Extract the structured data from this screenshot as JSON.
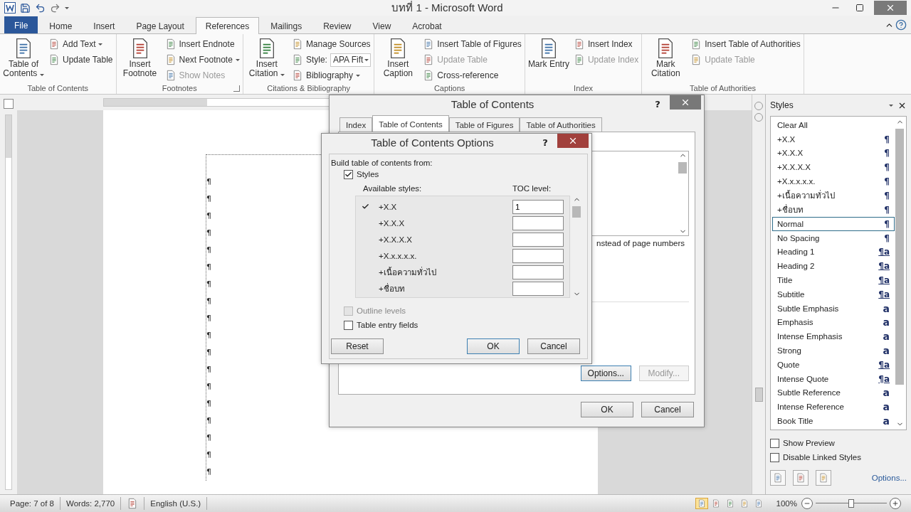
{
  "window": {
    "title": "บทที่ 1 - Microsoft Word"
  },
  "ribbon_tabs": [
    {
      "label": "File",
      "selected": false,
      "kind": "file"
    },
    {
      "label": "Home",
      "selected": false,
      "kind": "tab"
    },
    {
      "label": "Insert",
      "selected": false,
      "kind": "tab"
    },
    {
      "label": "Page Layout",
      "selected": false,
      "kind": "tab"
    },
    {
      "label": "References",
      "selected": true,
      "kind": "tab"
    },
    {
      "label": "Mailings",
      "selected": false,
      "kind": "tab"
    },
    {
      "label": "Review",
      "selected": false,
      "kind": "tab"
    },
    {
      "label": "View",
      "selected": false,
      "kind": "tab"
    },
    {
      "label": "Acrobat",
      "selected": false,
      "kind": "tab"
    }
  ],
  "ribbon_groups": [
    {
      "label": "Table of Contents",
      "launcher": false,
      "items": [
        {
          "kind": "large",
          "label": "Table of Contents",
          "dropdown": true,
          "disabled": false
        },
        {
          "kind": "small",
          "label": "Add Text",
          "dropdown": true,
          "disabled": false
        },
        {
          "kind": "small",
          "label": "Update Table",
          "dropdown": false,
          "disabled": false
        }
      ]
    },
    {
      "label": "Footnotes",
      "launcher": true,
      "items": [
        {
          "kind": "large",
          "label": "Insert Footnote",
          "dropdown": false,
          "disabled": false
        },
        {
          "kind": "small",
          "label": "Insert Endnote",
          "dropdown": false,
          "disabled": false
        },
        {
          "kind": "small",
          "label": "Next Footnote",
          "dropdown": true,
          "disabled": false
        },
        {
          "kind": "small",
          "label": "Show Notes",
          "dropdown": false,
          "disabled": true
        }
      ]
    },
    {
      "label": "Citations & Bibliography",
      "launcher": false,
      "items": [
        {
          "kind": "large",
          "label": "Insert Citation",
          "dropdown": true,
          "disabled": false
        },
        {
          "kind": "small",
          "label": "Manage Sources",
          "dropdown": false,
          "disabled": false
        },
        {
          "kind": "combo",
          "label": "Style:",
          "value": "APA Fift",
          "dropdown": true,
          "disabled": false
        },
        {
          "kind": "small",
          "label": "Bibliography",
          "dropdown": true,
          "disabled": false
        }
      ]
    },
    {
      "label": "Captions",
      "launcher": false,
      "items": [
        {
          "kind": "large",
          "label": "Insert Caption",
          "dropdown": false,
          "disabled": false
        },
        {
          "kind": "small",
          "label": "Insert Table of Figures",
          "dropdown": false,
          "disabled": false
        },
        {
          "kind": "small",
          "label": "Update Table",
          "dropdown": false,
          "disabled": true
        },
        {
          "kind": "small",
          "label": "Cross-reference",
          "dropdown": false,
          "disabled": false
        }
      ]
    },
    {
      "label": "Index",
      "launcher": false,
      "items": [
        {
          "kind": "large",
          "label": "Mark Entry",
          "dropdown": false,
          "disabled": false
        },
        {
          "kind": "small",
          "label": "Insert Index",
          "dropdown": false,
          "disabled": false
        },
        {
          "kind": "small",
          "label": "Update Index",
          "dropdown": false,
          "disabled": true
        }
      ]
    },
    {
      "label": "Table of Authorities",
      "launcher": false,
      "items": [
        {
          "kind": "large",
          "label": "Mark Citation",
          "dropdown": false,
          "disabled": false
        },
        {
          "kind": "small",
          "label": "Insert Table of Authorities",
          "dropdown": false,
          "disabled": false
        },
        {
          "kind": "small",
          "label": "Update Table",
          "dropdown": false,
          "disabled": true
        }
      ]
    }
  ],
  "document": {
    "paragraph_marks": [
      "¶",
      "¶",
      "¶",
      "¶",
      "¶",
      "¶",
      "¶",
      "¶",
      "¶",
      "¶",
      "¶",
      "¶",
      "¶",
      "¶",
      "¶",
      "¶",
      "¶",
      "¶"
    ]
  },
  "toc_dialog": {
    "title": "Table of Contents",
    "help": "?",
    "tabs": [
      {
        "label": "Index",
        "selected": false
      },
      {
        "label": "Table of Contents",
        "selected": true
      },
      {
        "label": "Table of Figures",
        "selected": false
      },
      {
        "label": "Table of Authorities",
        "selected": false
      }
    ],
    "hyperlinks_text": "nstead of page numbers",
    "buttons": [
      {
        "label": "Options...",
        "disabled": false
      },
      {
        "label": "Modify...",
        "disabled": true
      }
    ],
    "footer_buttons": [
      "OK",
      "Cancel"
    ]
  },
  "options_dialog": {
    "title": "Table of Contents Options",
    "help": "?",
    "build_from": "Build table of contents from:",
    "styles_checkbox": {
      "label": "Styles",
      "checked": true
    },
    "columns": [
      "Available styles:",
      "TOC level:"
    ],
    "styles": [
      {
        "name": "+X.X",
        "marked": true,
        "toc_level": "1"
      },
      {
        "name": "+X.X.X",
        "marked": false
      },
      {
        "name": "+X.X.X.X",
        "marked": false
      },
      {
        "name": "+X.x.x.x.x.",
        "marked": false
      },
      {
        "name": "+เนื้อความทั่วไป",
        "marked": false
      },
      {
        "name": "+ชื่อบท",
        "marked": false
      }
    ],
    "options": [
      {
        "label": "Outline levels",
        "checked": false,
        "disabled": true
      },
      {
        "label": "Table entry fields",
        "checked": false,
        "disabled": false
      }
    ],
    "buttons": [
      {
        "label": "Reset",
        "kind": "left",
        "default": false
      },
      {
        "label": "OK",
        "kind": "right",
        "default": true
      },
      {
        "label": "Cancel",
        "kind": "right",
        "default": false
      }
    ]
  },
  "styles_pane": {
    "title": "Styles",
    "items": [
      {
        "name": "Clear All",
        "selected": false
      },
      {
        "name": "+X.X",
        "symbol": "¶",
        "kind": "paragraph",
        "selected": false
      },
      {
        "name": "+X.X.X",
        "symbol": "¶",
        "kind": "paragraph",
        "selected": false
      },
      {
        "name": "+X.X.X.X",
        "symbol": "¶",
        "kind": "paragraph",
        "selected": false
      },
      {
        "name": "+X.x.x.x.x.",
        "symbol": "¶",
        "kind": "paragraph",
        "selected": false
      },
      {
        "name": "+เนื้อความทั่วไป",
        "symbol": "¶",
        "kind": "paragraph",
        "selected": false
      },
      {
        "name": "+ชื่อบท",
        "symbol": "¶",
        "kind": "paragraph",
        "selected": false
      },
      {
        "name": "Normal",
        "symbol": "¶",
        "kind": "paragraph",
        "selected": true
      },
      {
        "name": "No Spacing",
        "symbol": "¶",
        "kind": "paragraph",
        "selected": false
      },
      {
        "name": "Heading 1",
        "symbol": "¶a",
        "kind": "linked",
        "selected": false
      },
      {
        "name": "Heading 2",
        "symbol": "¶a",
        "kind": "linked",
        "selected": false
      },
      {
        "name": "Title",
        "symbol": "¶a",
        "kind": "linked",
        "selected": false
      },
      {
        "name": "Subtitle",
        "symbol": "¶a",
        "kind": "linked",
        "selected": false
      },
      {
        "name": "Subtle Emphasis",
        "symbol": "a",
        "kind": "character",
        "selected": false
      },
      {
        "name": "Emphasis",
        "symbol": "a",
        "kind": "character",
        "selected": false
      },
      {
        "name": "Intense Emphasis",
        "symbol": "a",
        "kind": "character",
        "selected": false
      },
      {
        "name": "Strong",
        "symbol": "a",
        "kind": "character",
        "selected": false
      },
      {
        "name": "Quote",
        "symbol": "¶a",
        "kind": "linked",
        "selected": false
      },
      {
        "name": "Intense Quote",
        "symbol": "¶a",
        "kind": "linked",
        "selected": false
      },
      {
        "name": "Subtle Reference",
        "symbol": "a",
        "kind": "character",
        "selected": false
      },
      {
        "name": "Intense Reference",
        "symbol": "a",
        "kind": "character",
        "selected": false
      },
      {
        "name": "Book Title",
        "symbol": "a",
        "kind": "character",
        "selected": false
      }
    ],
    "checkboxes": [
      {
        "label": "Show Preview",
        "checked": false
      },
      {
        "label": "Disable Linked Styles",
        "checked": false
      }
    ],
    "options_link": "Options..."
  },
  "status_bar": {
    "page": "Page: 7 of 8",
    "words": "Words: 2,770",
    "language": "English (U.S.)",
    "views": [
      {
        "selected": true
      },
      {
        "selected": false
      },
      {
        "selected": false
      },
      {
        "selected": false
      },
      {
        "selected": false
      }
    ],
    "zoom": {
      "reading": "100%",
      "level": 0.5
    }
  }
}
